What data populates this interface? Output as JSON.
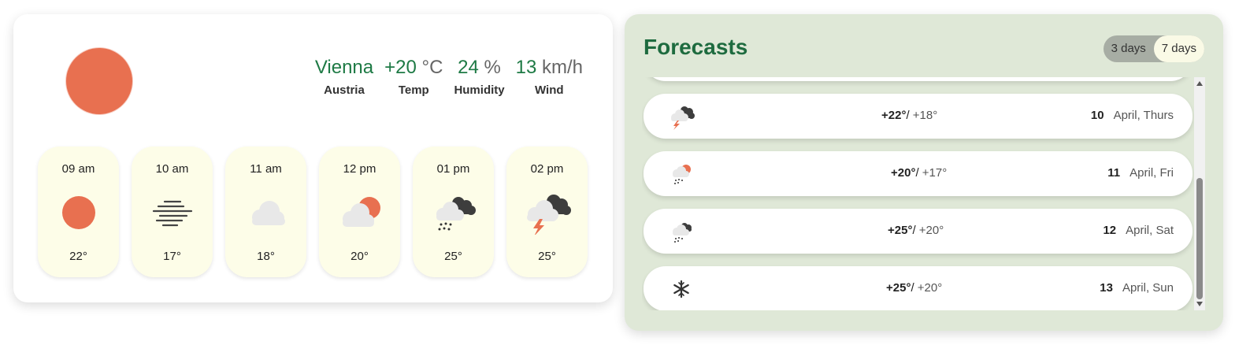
{
  "current": {
    "icon": "sun-icon",
    "city": "Vienna",
    "country": "Austria",
    "temp_value": "+20",
    "temp_unit": "°C",
    "temp_label": "Temp",
    "humidity_value": "24",
    "humidity_unit": "%",
    "humidity_label": "Humidity",
    "wind_value": "13",
    "wind_unit": "km/h",
    "wind_label": "Wind"
  },
  "hourly": [
    {
      "time": "09 am",
      "icon": "sun-icon",
      "temp": "22°"
    },
    {
      "time": "10 am",
      "icon": "fog-icon",
      "temp": "17°"
    },
    {
      "time": "11 am",
      "icon": "cloud-icon",
      "temp": "18°"
    },
    {
      "time": "12 pm",
      "icon": "partly-cloudy-icon",
      "temp": "20°"
    },
    {
      "time": "01 pm",
      "icon": "rain-cloud-icon",
      "temp": "25°"
    },
    {
      "time": "02 pm",
      "icon": "thunderstorm-icon",
      "temp": "25°"
    }
  ],
  "forecasts": {
    "title": "Forecasts",
    "toggle": {
      "option_3": "3 days",
      "option_7": "7 days",
      "selected": "7 days"
    },
    "rows": [
      {
        "icon": "thunderstorm-icon",
        "high": "+22°",
        "low": "+18°",
        "day": "10",
        "month": "April,",
        "weekday": "Thurs"
      },
      {
        "icon": "sun-rain-icon",
        "high": "+20°",
        "low": "+17°",
        "day": "11",
        "month": "April,",
        "weekday": "Fri"
      },
      {
        "icon": "rain-cloud-icon",
        "high": "+25°",
        "low": "+20°",
        "day": "12",
        "month": "April,",
        "weekday": "Sat"
      },
      {
        "icon": "snowflake-icon",
        "high": "+25°",
        "low": "+20°",
        "day": "13",
        "month": "April,",
        "weekday": "Sun"
      }
    ]
  },
  "colors": {
    "accent_green": "#1e7a45",
    "sun": "#e87050",
    "hour_card_bg": "#fdfde8",
    "forecast_bg": "#dfe8d7"
  }
}
